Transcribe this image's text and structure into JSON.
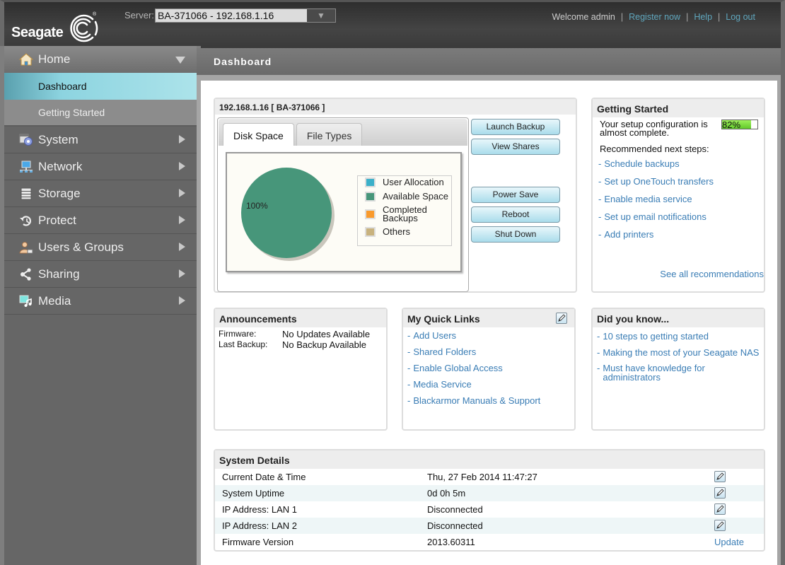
{
  "header": {
    "brand": "Seagate",
    "server_label": "Server:",
    "server_value": "BA-371066 - 192.168.1.16",
    "welcome": "Welcome admin",
    "links": [
      "Register now",
      "Help",
      "Log out"
    ]
  },
  "sidebar": {
    "items": [
      {
        "label": "Home",
        "icon": "home-icon",
        "expanded": true,
        "children": [
          {
            "label": "Dashboard",
            "active": true
          },
          {
            "label": "Getting Started",
            "active": false
          }
        ]
      },
      {
        "label": "System",
        "icon": "system-gear-icon"
      },
      {
        "label": "Network",
        "icon": "network-icon"
      },
      {
        "label": "Storage",
        "icon": "storage-icon"
      },
      {
        "label": "Protect",
        "icon": "protect-icon"
      },
      {
        "label": "Users & Groups",
        "icon": "users-icon"
      },
      {
        "label": "Sharing",
        "icon": "share-icon"
      },
      {
        "label": "Media",
        "icon": "media-icon"
      }
    ]
  },
  "page": {
    "title": "Dashboard"
  },
  "device": {
    "title": "192.168.1.16 [ BA-371066 ]",
    "tabs": [
      "Disk Space",
      "File Types"
    ],
    "active_tab": "Disk Space",
    "buttons_top": [
      "Launch Backup",
      "View Shares"
    ],
    "buttons_bottom": [
      "Power Save",
      "Reboot",
      "Shut Down"
    ]
  },
  "chart_data": {
    "type": "pie",
    "title": "Disk Space",
    "series": [
      {
        "name": "User Allocation",
        "value": 0,
        "color": "#3bb0c9"
      },
      {
        "name": "Available Space",
        "value": 100,
        "color": "#47967a"
      },
      {
        "name": "Completed Backups",
        "value": 0,
        "color": "#f99a2c"
      },
      {
        "name": "Others",
        "value": 0,
        "color": "#c8b27e"
      }
    ],
    "data_label": "100%",
    "legend": "right"
  },
  "getting_started": {
    "title": "Getting Started",
    "status_text": "Your setup configuration is almost complete.",
    "progress_percent": 82,
    "progress_label": "82%",
    "next_steps_label": "Recommended next steps:",
    "steps": [
      "Schedule backups",
      "Set up OneTouch transfers",
      "Enable media service",
      "Set up email notifications",
      "Add printers"
    ],
    "see_all": "See all recommendations"
  },
  "announcements": {
    "title": "Announcements",
    "rows": [
      {
        "label": "Firmware:",
        "value": "No Updates Available"
      },
      {
        "label": "Last Backup:",
        "value": "No Backup Available"
      }
    ]
  },
  "quick_links": {
    "title": "My Quick Links",
    "links": [
      "Add Users",
      "Shared Folders",
      "Enable Global Access",
      "Media Service",
      "Blackarmor Manuals & Support"
    ]
  },
  "did_you_know": {
    "title": "Did you know...",
    "links": [
      "10 steps to getting started",
      "Making the most of your Seagate NAS",
      "Must have knowledge for administrators"
    ]
  },
  "system_details": {
    "title": "System Details",
    "rows": [
      {
        "label": "Current Date & Time",
        "value": "Thu, 27 Feb 2014 11:47:27",
        "action": "edit"
      },
      {
        "label": "System Uptime",
        "value": "0d 0h 5m",
        "action": "edit"
      },
      {
        "label": "IP Address: LAN 1",
        "value": "Disconnected",
        "action": "edit"
      },
      {
        "label": "IP Address: LAN 2",
        "value": "Disconnected",
        "action": "edit"
      },
      {
        "label": "Firmware Version",
        "value": "2013.60311",
        "action": "Update"
      }
    ]
  }
}
